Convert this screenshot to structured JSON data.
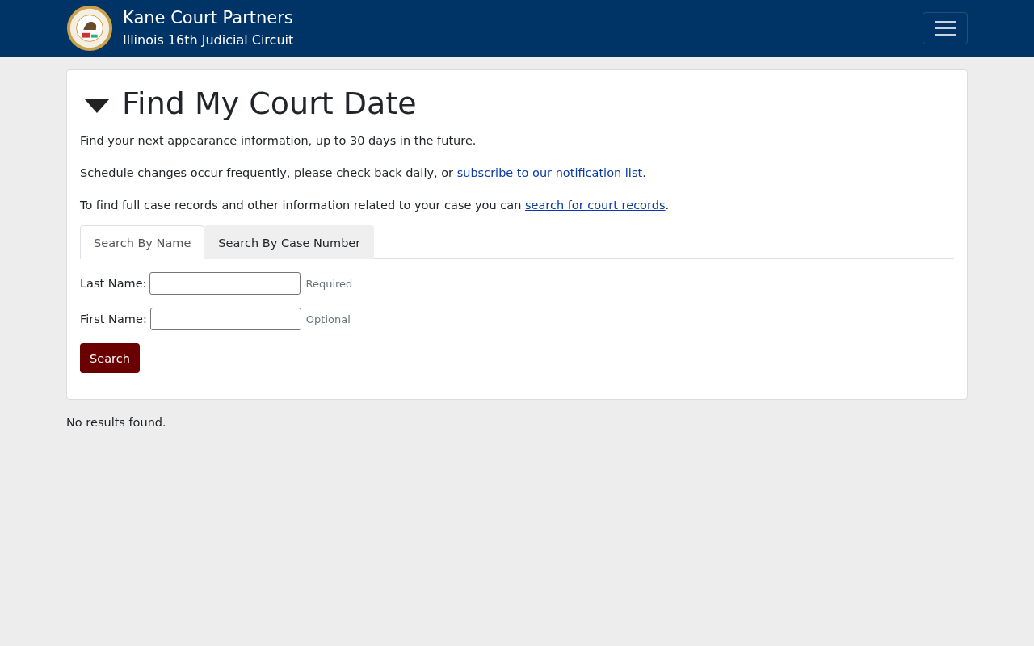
{
  "header": {
    "title": "Kane Court Partners",
    "subtitle": "Illinois 16th Judicial Circuit"
  },
  "card": {
    "title": "Find My Court Date",
    "expanded": true,
    "paragraphs": [
      {
        "text": "Find your next appearance information, up to 30 days in the future."
      },
      {
        "text": "Schedule changes occur frequently, please check back daily, or ",
        "link": "subscribe to our notification list",
        "after": "."
      },
      {
        "text": "To find full case records and other information related to your case you can ",
        "link": "search for court records",
        "after": "."
      }
    ],
    "tabs": [
      {
        "label": "Search By Name",
        "selected": true
      },
      {
        "label": "Search By Case Number",
        "selected": false
      }
    ],
    "fields": [
      {
        "label": "Last Name:",
        "hint": "Required"
      },
      {
        "label": "First Name:",
        "hint": "Optional"
      }
    ],
    "button": "Search"
  },
  "results": "No results found."
}
